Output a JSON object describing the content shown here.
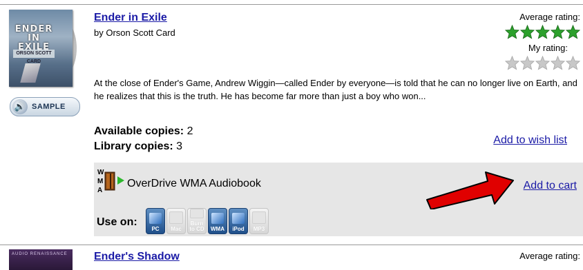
{
  "book1": {
    "cover_title": "ENDER IN EXILE",
    "cover_author": "ORSON SCOTT CARD",
    "sample_label": "SAMPLE",
    "title": "Ender in Exile",
    "author": "by Orson Scott Card",
    "average_rating_label": "Average rating:",
    "average_rating": 5,
    "my_rating_label": "My rating:",
    "my_rating": 0,
    "description": "At the close of Ender's Game, Andrew Wiggin—called Ender by everyone—is told that he can no longer live on Earth, and he realizes that this is the truth. He has become far more than just a boy who won...",
    "available_label": "Available copies:",
    "available_value": "2",
    "library_label": "Library copies:",
    "library_value": "3",
    "wish_list_link": "Add to wish list",
    "format": {
      "icon_letters": [
        "W",
        "M",
        "A"
      ],
      "name": "OverDrive WMA Audiobook",
      "add_to_cart": "Add to cart",
      "use_on_label": "Use on:",
      "devices": [
        {
          "label": "PC",
          "enabled": true
        },
        {
          "label": "Mac",
          "enabled": false
        },
        {
          "label": "Burn to CD",
          "enabled": false
        },
        {
          "label": "WMA",
          "enabled": true
        },
        {
          "label": "iPod",
          "enabled": true
        },
        {
          "label": "MP3",
          "enabled": false
        }
      ]
    }
  },
  "book2": {
    "cover_text": "AUDIO RENAISSANCE",
    "title": "Ender's Shadow",
    "average_rating_label": "Average rating:"
  },
  "colors": {
    "link": "#1a1aa6",
    "star_filled": "#2ca12c",
    "star_empty": "#c8c8c8",
    "arrow": "#e00000",
    "format_box": "#e6e6e6"
  }
}
